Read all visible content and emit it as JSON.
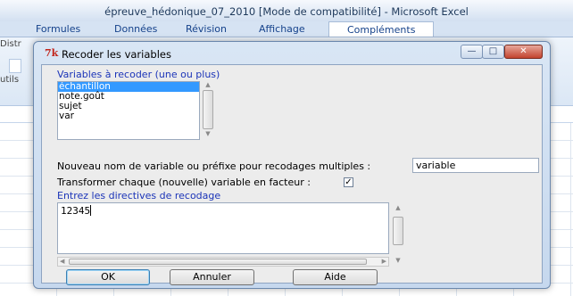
{
  "excel": {
    "window_title": "épreuve_hédonique_07_2010  [Mode de compatibilité] - Microsoft Excel",
    "ribbon_tabs": [
      {
        "label": "Formules"
      },
      {
        "label": "Données"
      },
      {
        "label": "Révision"
      },
      {
        "label": "Affichage"
      },
      {
        "label": "Compléments",
        "active": true
      }
    ],
    "ribbon_fragment_1": "Distr",
    "ribbon_fragment_2": "utils"
  },
  "dialog": {
    "title": "Recoder les variables",
    "app_icon": "tk-feather-icon",
    "window_buttons": {
      "minimize": "minimize-icon",
      "maximize": "maximize-icon",
      "close": "close-icon"
    },
    "variables_label": "Variables à recoder (une ou plus)",
    "variables": [
      {
        "name": "échantillon",
        "selected": true
      },
      {
        "name": "note.goût",
        "selected": false
      },
      {
        "name": "sujet",
        "selected": false
      },
      {
        "name": "var",
        "selected": false
      }
    ],
    "new_name_label": "Nouveau nom de variable ou préfixe pour recodages multiples :",
    "new_name_value": "variable",
    "factor_label": "Transformer chaque (nouvelle) variable en facteur :",
    "factor_checked": true,
    "factor_check_glyph": "✓",
    "directives_label": "Entrez les directives de recodage",
    "directives_value": "12345",
    "buttons": {
      "ok": "OK",
      "cancel": "Annuler",
      "help": "Aide"
    }
  }
}
